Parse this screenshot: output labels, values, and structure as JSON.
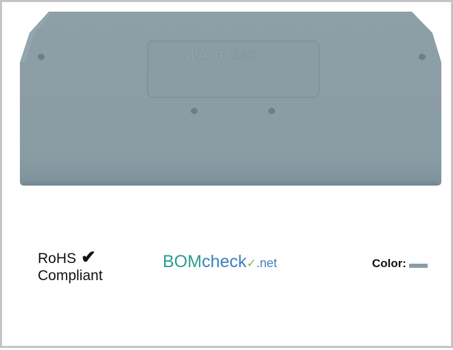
{
  "product": {
    "name": "end plate",
    "brand_text": "WAGO",
    "series_text": "280",
    "body_color": "#8a9ca5"
  },
  "rohs": {
    "line1": "RoHS",
    "line2": "Compliant",
    "check": "✔"
  },
  "bomcheck": {
    "main": "BOM",
    "check": "check",
    "mark": "✓",
    "net": ".net"
  },
  "color_indicator": {
    "label": "Color:",
    "swatch": "#8a9ca5"
  }
}
